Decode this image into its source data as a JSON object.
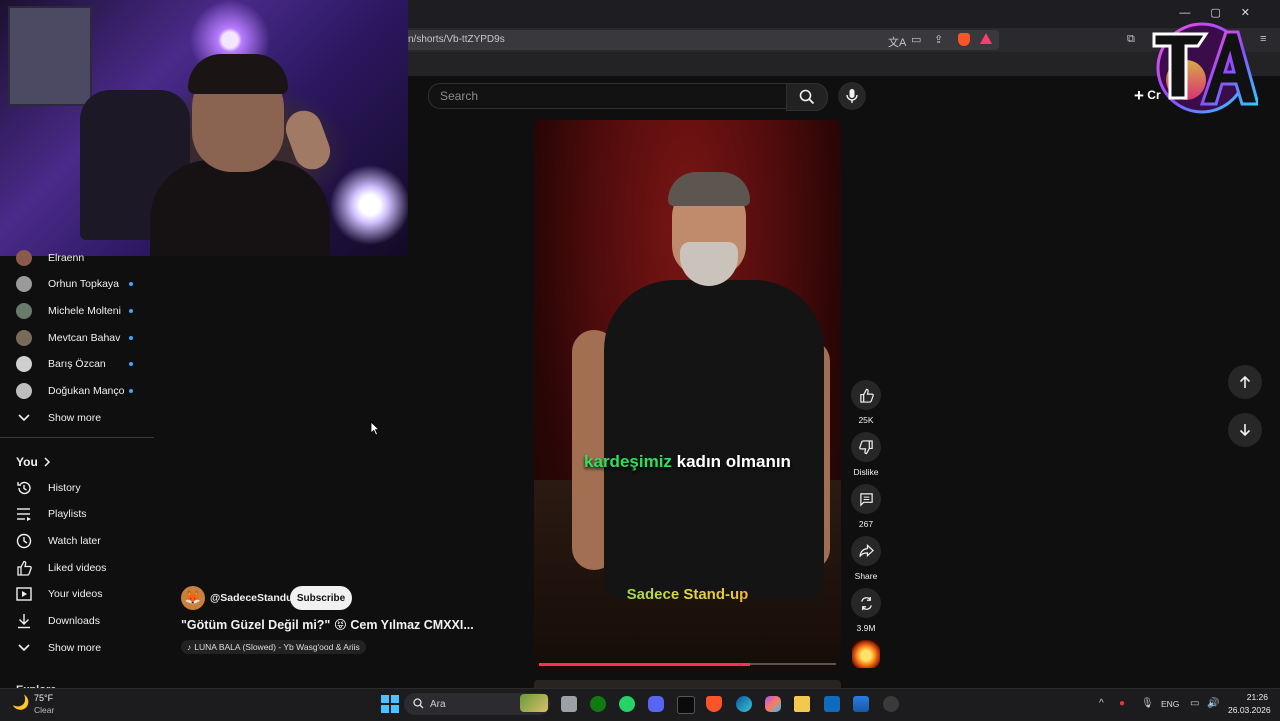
{
  "browser": {
    "url": "n/shorts/Vb-ttZYPD9s",
    "window_controls": [
      "—",
      "▢",
      "✕"
    ]
  },
  "search": {
    "placeholder": "Search"
  },
  "header": {
    "create_label": "Cr"
  },
  "sidebar": {
    "subscriptions": [
      {
        "name": "Elraenn",
        "color": "#8a5a4a"
      },
      {
        "name": "Orhun Topkaya",
        "color": "#9a9a9a"
      },
      {
        "name": "Michele Molteni",
        "color": "#6a7a6a"
      },
      {
        "name": "Mevtcan Bahav",
        "color": "#7a6a5a"
      },
      {
        "name": "Barış Özcan",
        "color": "#cfcfcf"
      },
      {
        "name": "Doğukan Manço",
        "color": "#bdbdbd"
      }
    ],
    "show_more_1": "Show more",
    "you_heading": "You",
    "you_items": [
      {
        "label": "History",
        "icon": "history-icon"
      },
      {
        "label": "Playlists",
        "icon": "playlists-icon"
      },
      {
        "label": "Watch later",
        "icon": "watch-later-icon"
      },
      {
        "label": "Liked videos",
        "icon": "liked-videos-icon"
      },
      {
        "label": "Your videos",
        "icon": "your-videos-icon"
      },
      {
        "label": "Downloads",
        "icon": "downloads-icon"
      }
    ],
    "show_more_2": "Show more",
    "explore_heading": "Explore"
  },
  "short": {
    "caption_highlight": "kardeşimiz",
    "caption_rest": " kadın olmanın",
    "watermark": "Sadece Stand-up",
    "progress": 0.71,
    "channel": "@SadeceStandup",
    "subscribe_label": "Subscribe",
    "title": "\"Götüm Güzel Değil mi?\" 😝 Cem Yılmaz CMXXI...",
    "music": "LUNA BALA (Slowed) - Yb Wasg'ood & Ariis"
  },
  "actions": {
    "like_count": "25K",
    "dislike_label": "Dislike",
    "comments_count": "267",
    "share_label": "Share",
    "remix_count": "3.9M"
  },
  "taskbar": {
    "weather_temp": "75°F",
    "weather_cond": "Clear",
    "search_placeholder": "Ara",
    "lang": "ENG",
    "time": "21:26",
    "date": "26.03.2026",
    "accent": "#4cc2ff"
  }
}
